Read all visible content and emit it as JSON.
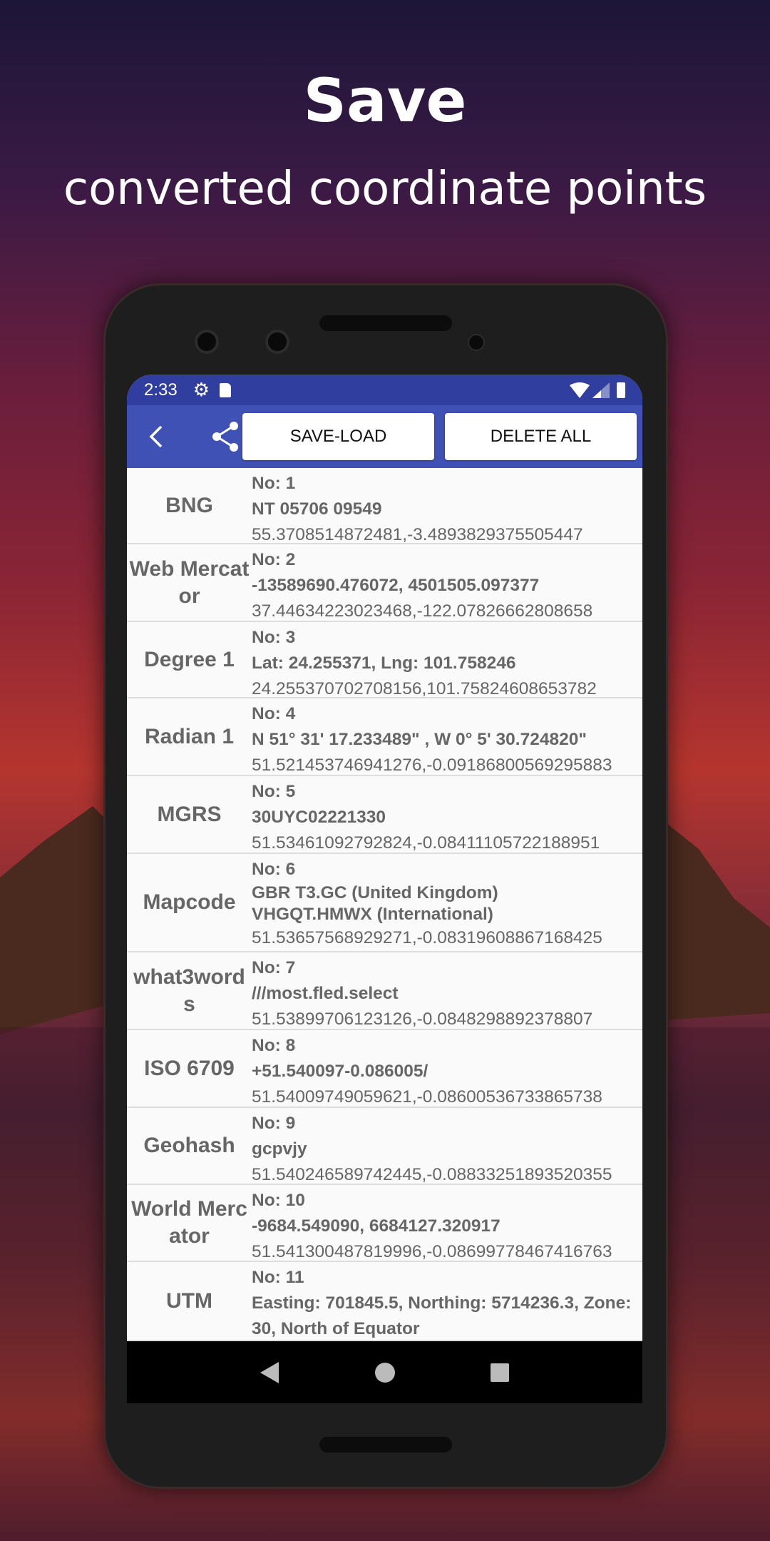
{
  "headline": {
    "title": "Save",
    "subtitle": "converted coordinate points"
  },
  "status_bar": {
    "time": "2:33",
    "icons": [
      "settings-icon",
      "sd-card-icon",
      "wifi-icon",
      "signal-icon",
      "battery-icon"
    ]
  },
  "toolbar": {
    "back_icon": "chevron-left-icon",
    "share_icon": "share-icon",
    "save_load_label": "SAVE-LOAD",
    "delete_all_label": "DELETE ALL"
  },
  "colors": {
    "status_bar": "#303f9f",
    "toolbar": "#3f51b5",
    "text": "#666666"
  },
  "points": [
    {
      "label": "BNG",
      "no": "No: 1",
      "lines": [
        "NT 05706 09549"
      ],
      "latlng": "55.3708514872481,-3.4893829375505447"
    },
    {
      "label": "Web Mercator",
      "no": "No: 2",
      "lines": [
        "-13589690.476072, 4501505.097377"
      ],
      "latlng": "37.44634223023468,-122.07826662808658"
    },
    {
      "label": "Degree 1",
      "no": "No: 3",
      "lines": [
        "Lat: 24.255371, Lng: 101.758246"
      ],
      "latlng": "24.255370702708156,101.75824608653782"
    },
    {
      "label": "Radian 1",
      "no": "No: 4",
      "lines": [
        "N 51° 31' 17.233489\" , W 0° 5' 30.724820\""
      ],
      "latlng": "51.521453746941276,-0.09186800569295883"
    },
    {
      "label": "MGRS",
      "no": "No: 5",
      "lines": [
        "30UYC02221330"
      ],
      "latlng": "51.53461092792824,-0.08411105722188951"
    },
    {
      "label": "Mapcode",
      "no": "No: 6",
      "lines": [
        "GBR T3.GC (United Kingdom)",
        "VHGQT.HMWX (International)"
      ],
      "latlng": "51.53657568929271,-0.08319608867168425"
    },
    {
      "label": "what3words",
      "no": "No: 7",
      "lines": [
        "///most.fled.select"
      ],
      "latlng": "51.53899706123126,-0.0848298892378807"
    },
    {
      "label": "ISO 6709",
      "no": "No: 8",
      "lines": [
        "+51.540097-0.086005/"
      ],
      "latlng": "51.54009749059621,-0.08600536733865738"
    },
    {
      "label": "Geohash",
      "no": "No: 9",
      "lines": [
        "gcpvjy"
      ],
      "latlng": "51.540246589742445,-0.08833251893520355"
    },
    {
      "label": "World Mercator",
      "no": "No: 10",
      "lines": [
        "-9684.549090, 6684127.320917"
      ],
      "latlng": "51.541300487819996,-0.08699778467416763"
    },
    {
      "label": "UTM",
      "no": "No: 11",
      "lines": [
        "Easting: 701845.5, Northing: 5714236.3, Zone: 30, North of Equator"
      ],
      "latlng": ""
    }
  ],
  "nav_bar": {
    "icons": [
      "back-triangle-icon",
      "home-circle-icon",
      "recents-square-icon"
    ]
  }
}
